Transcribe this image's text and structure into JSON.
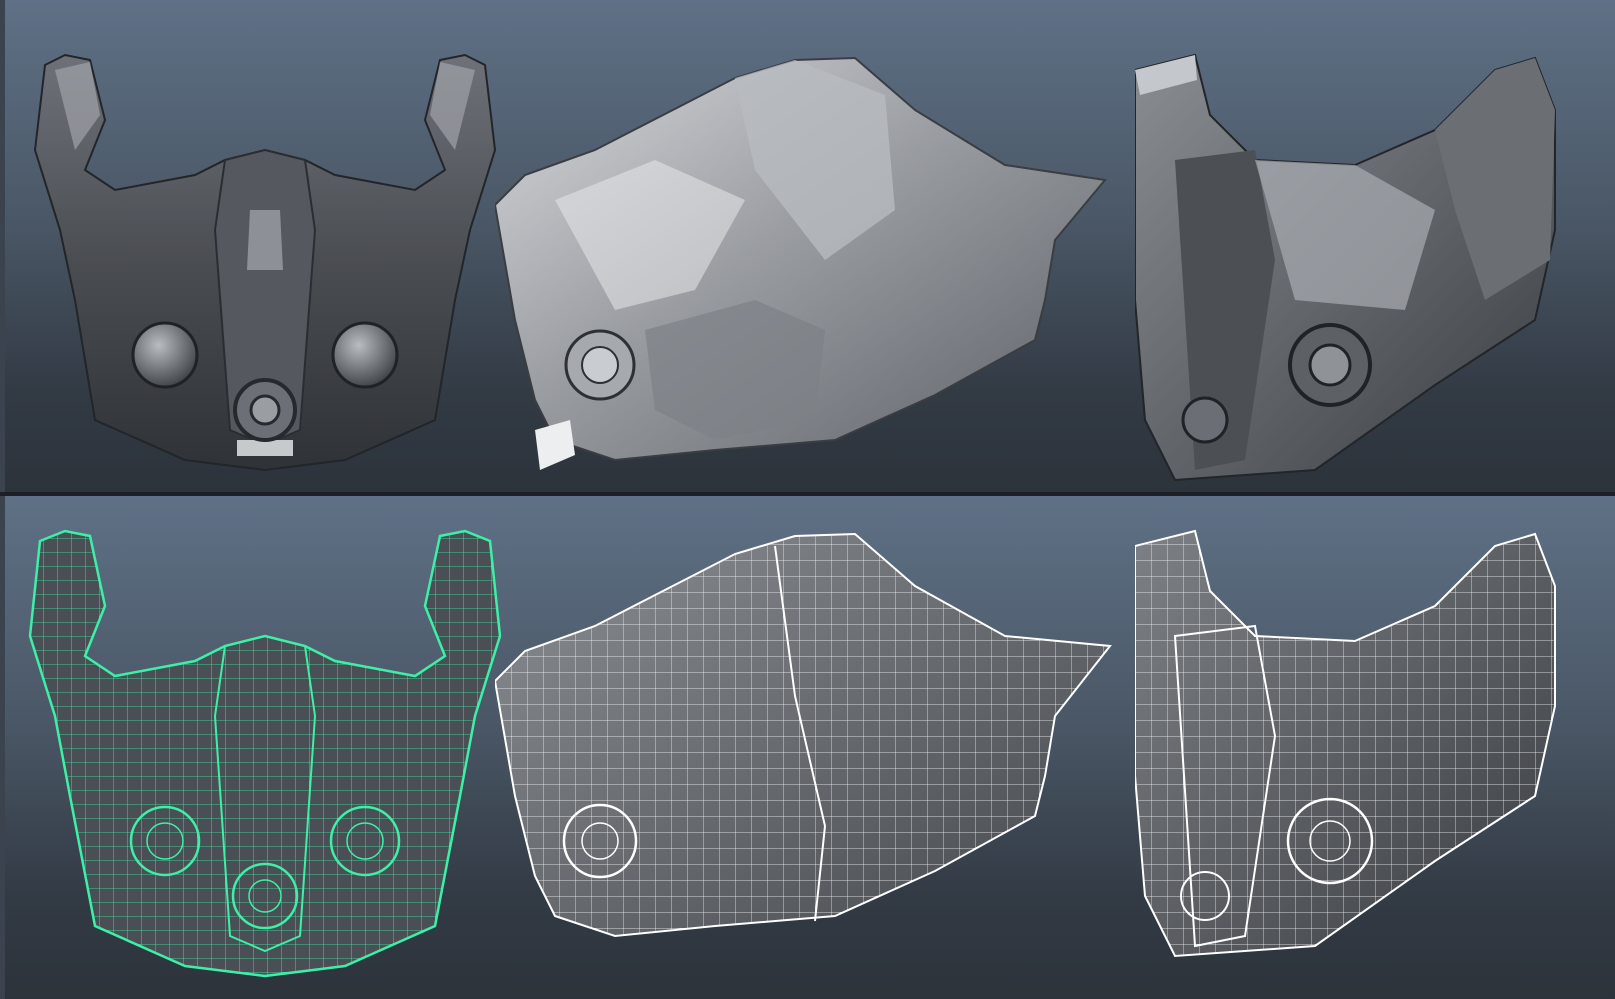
{
  "viewports": {
    "top": {
      "shading": "smooth-shaded",
      "views": [
        "front",
        "side",
        "three-quarter"
      ]
    },
    "bottom": {
      "shading": "wireframe-on-shaded",
      "views": [
        "front-selected",
        "side",
        "three-quarter"
      ]
    }
  },
  "colors": {
    "viewport_top": "#5f7186",
    "viewport_bottom": "#2c333b",
    "selection_wire": "#3df0a8",
    "wire": "#ffffff",
    "mesh_dark": "#3a3d42",
    "mesh_mid": "#7b7f86",
    "mesh_light": "#c9ccd0"
  }
}
